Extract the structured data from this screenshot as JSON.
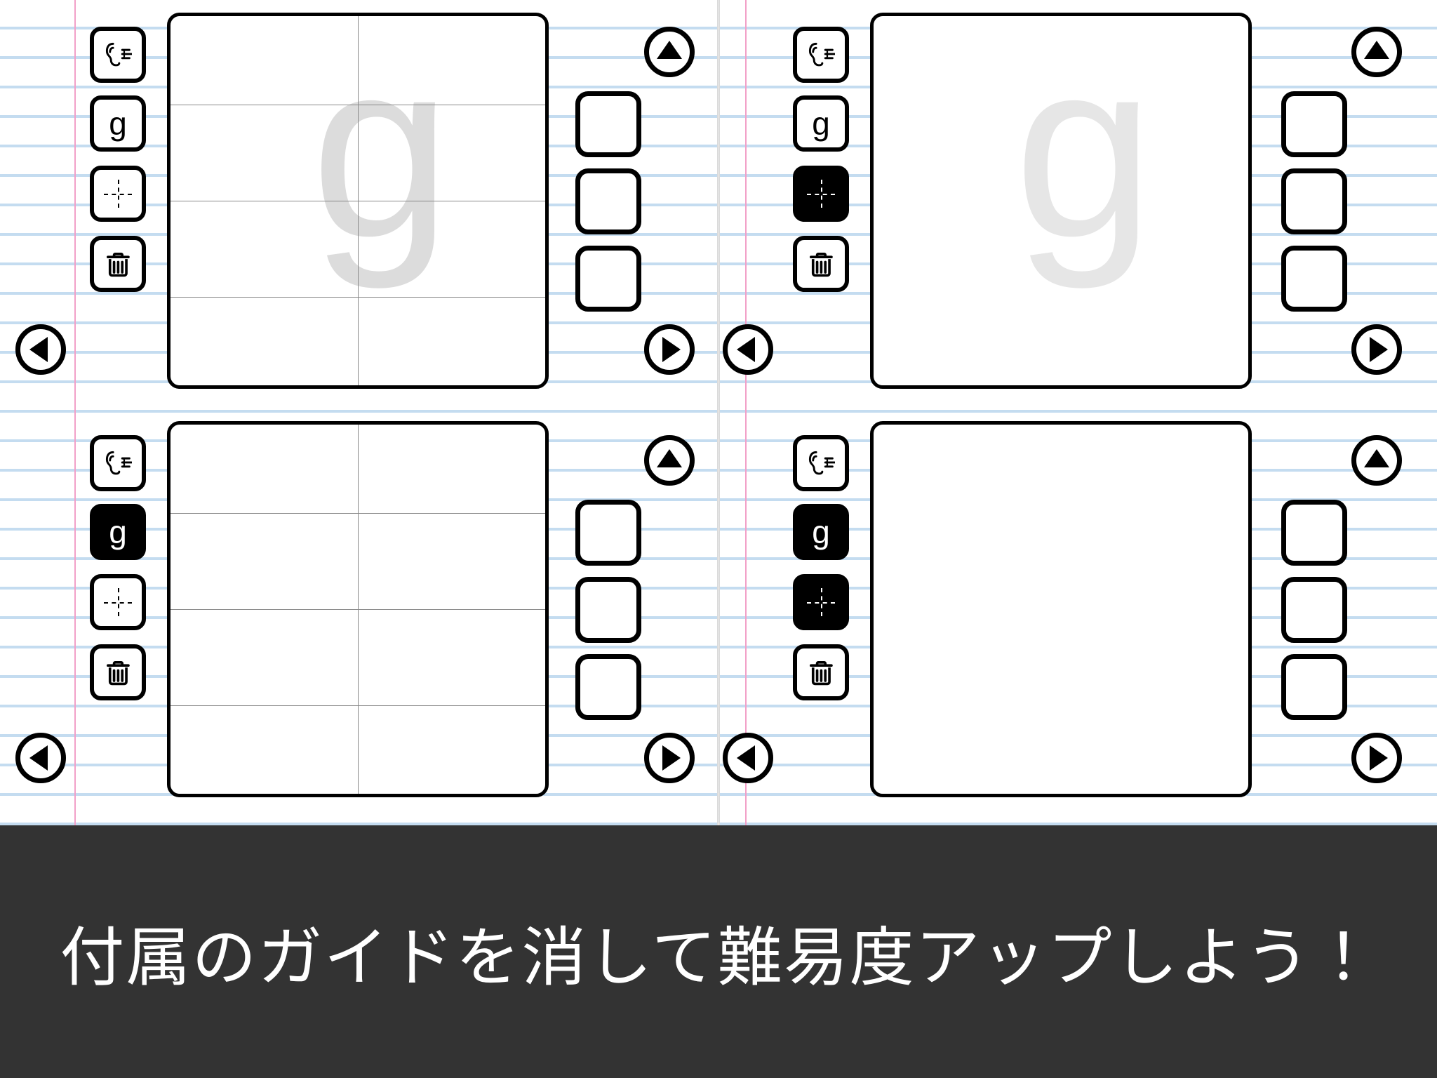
{
  "caption": "付属のガイドを消して難易度アップしよう！",
  "letter": "g",
  "panels": [
    {
      "id": "top-left",
      "tools": {
        "letter_inverted": false,
        "grid_inverted": false
      },
      "canvas": {
        "show_guidelines": true,
        "show_dotted_cross": true,
        "ghost_letter": "g"
      }
    },
    {
      "id": "top-right",
      "tools": {
        "letter_inverted": false,
        "grid_inverted": true
      },
      "canvas": {
        "show_guidelines": false,
        "show_dotted_cross": false,
        "ghost_letter": "g"
      }
    },
    {
      "id": "bottom-left",
      "tools": {
        "letter_inverted": true,
        "grid_inverted": false
      },
      "canvas": {
        "show_guidelines": true,
        "show_dotted_cross": true,
        "ghost_letter": ""
      }
    },
    {
      "id": "bottom-right",
      "tools": {
        "letter_inverted": true,
        "grid_inverted": true
      },
      "canvas": {
        "show_guidelines": false,
        "show_dotted_cross": false,
        "ghost_letter": ""
      }
    }
  ]
}
